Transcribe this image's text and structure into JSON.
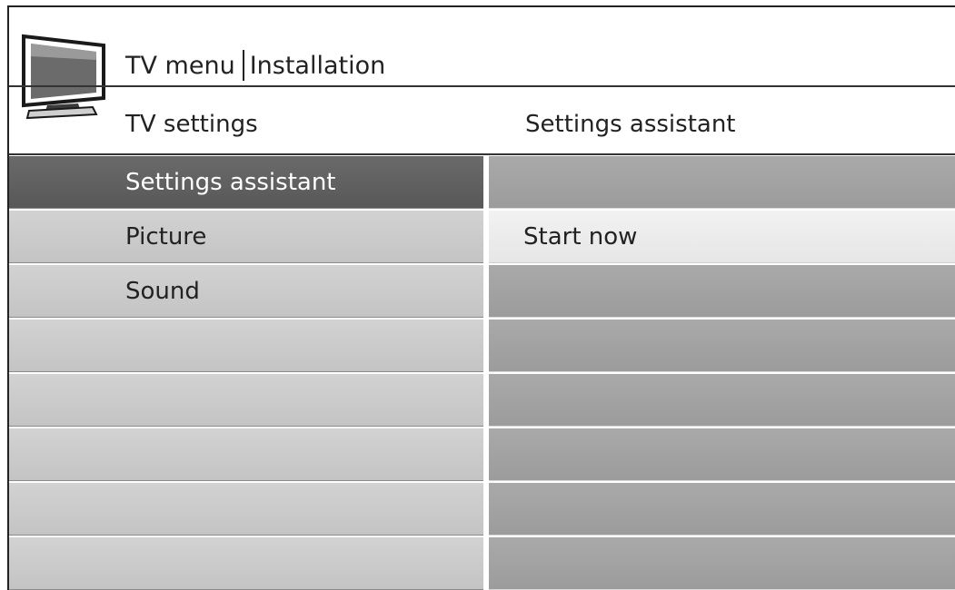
{
  "header": {
    "menu_label": "TV menu",
    "section_label": "Installation"
  },
  "columns": {
    "left_heading": "TV settings",
    "right_heading": "Settings assistant"
  },
  "left_list": {
    "items": [
      "Settings assistant",
      "Picture",
      "Sound",
      "",
      "",
      "",
      "",
      ""
    ],
    "selected_index": 0
  },
  "right_list": {
    "items": [
      "",
      "Start now",
      "",
      "",
      "",
      "",
      "",
      ""
    ],
    "highlighted_index": 1
  },
  "icons": {
    "logo": "tv-icon"
  },
  "colors": {
    "selected_row": "#5f5f5f",
    "left_row": "#cbcbcb",
    "right_row": "#a3a3a3",
    "highlight_row": "#ececec"
  }
}
